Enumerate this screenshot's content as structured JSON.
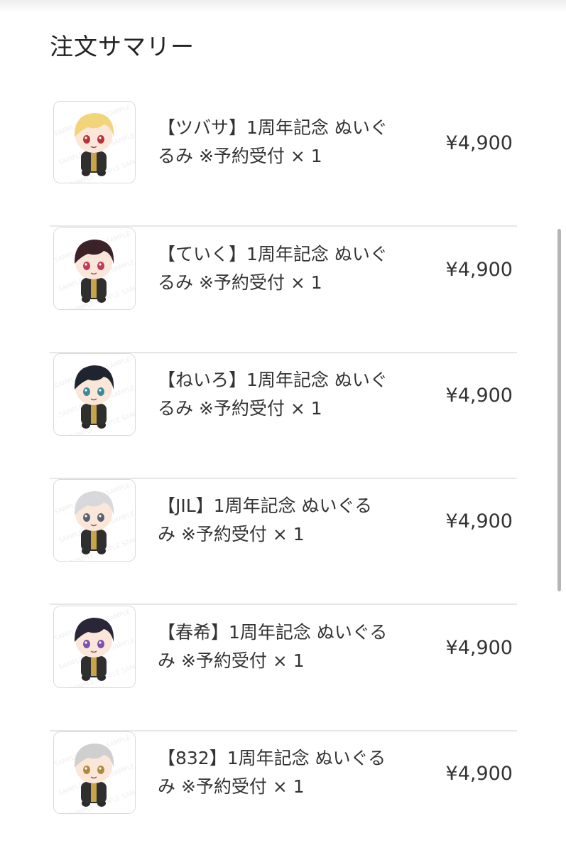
{
  "summary": {
    "title": "注文サマリー"
  },
  "items": [
    {
      "name_line1": "【ツバサ】1周年記念 ぬいぐ",
      "name_line2": "るみ ※予約受付 × 1",
      "price": "¥4,900",
      "hair": "#f2d57a",
      "eyes": "#b8323a"
    },
    {
      "name_line1": "【ていく】1周年記念 ぬいぐ",
      "name_line2": "るみ ※予約受付 × 1",
      "price": "¥4,900",
      "hair": "#3a2228",
      "eyes": "#c23a5a"
    },
    {
      "name_line1": "【ねいろ】1周年記念 ぬいぐ",
      "name_line2": "るみ ※予約受付 × 1",
      "price": "¥4,900",
      "hair": "#1e2530",
      "eyes": "#3a8a9a"
    },
    {
      "name_line1": "【JIL】1周年記念 ぬいぐる",
      "name_line2": "み ※予約受付 × 1",
      "price": "¥4,900",
      "hair": "#d8d8dc",
      "eyes": "#5a6070"
    },
    {
      "name_line1": "【春希】1周年記念 ぬいぐる",
      "name_line2": "み ※予約受付 × 1",
      "price": "¥4,900",
      "hair": "#2a2638",
      "eyes": "#7a52b0"
    },
    {
      "name_line1": "【832】1周年記念 ぬいぐる",
      "name_line2": "み ※予約受付 × 1",
      "price": "¥4,900",
      "hair": "#cfcfcf",
      "eyes": "#b08a3a"
    }
  ]
}
